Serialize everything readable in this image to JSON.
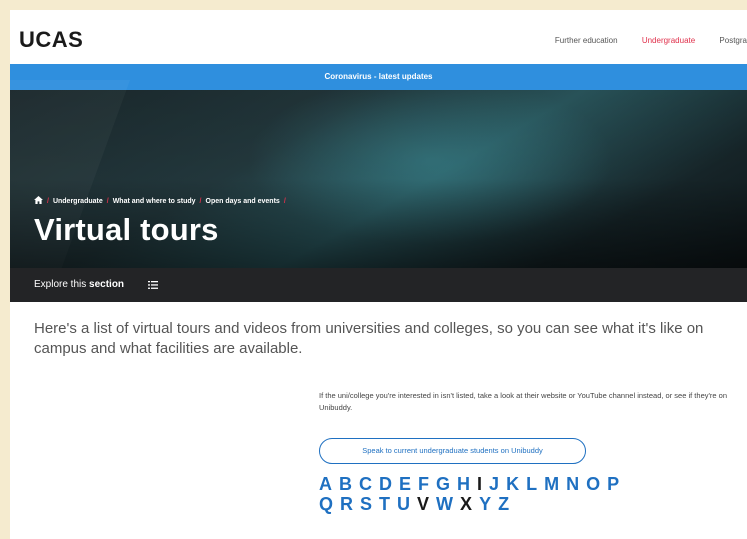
{
  "header": {
    "logo": "UCAS",
    "nav": [
      {
        "label": "Further education",
        "active": false
      },
      {
        "label": "Undergraduate",
        "active": true
      },
      {
        "label": "Postgra",
        "active": false
      }
    ]
  },
  "banner": {
    "text": "Coronavirus - latest updates"
  },
  "breadcrumb": [
    {
      "label": "Undergraduate"
    },
    {
      "label": "What and where to study"
    },
    {
      "label": "Open days and events"
    }
  ],
  "page_title": "Virtual tours",
  "explore": {
    "label_prefix": "Explore this ",
    "label_strong": "section"
  },
  "intro": "Here's a list of virtual tours and videos from universities and colleges, so you can see what it's like on campus and what facilities are available.",
  "note": "If the uni/college you're interested in isn't listed, take a look at their website or YouTube channel instead, or see if they're on Unibuddy.",
  "unibuddy_button": "Speak to current undergraduate students on Unibuddy",
  "alphabet": [
    {
      "letter": "A",
      "active": true
    },
    {
      "letter": "B",
      "active": true
    },
    {
      "letter": "C",
      "active": true
    },
    {
      "letter": "D",
      "active": true
    },
    {
      "letter": "E",
      "active": true
    },
    {
      "letter": "F",
      "active": true
    },
    {
      "letter": "G",
      "active": true
    },
    {
      "letter": "H",
      "active": true
    },
    {
      "letter": "I",
      "active": false
    },
    {
      "letter": "J",
      "active": true
    },
    {
      "letter": "K",
      "active": true
    },
    {
      "letter": "L",
      "active": true
    },
    {
      "letter": "M",
      "active": true
    },
    {
      "letter": "N",
      "active": true
    },
    {
      "letter": "O",
      "active": true
    },
    {
      "letter": "P",
      "active": true
    },
    {
      "letter": "Q",
      "active": true
    },
    {
      "letter": "R",
      "active": true
    },
    {
      "letter": "S",
      "active": true
    },
    {
      "letter": "T",
      "active": true
    },
    {
      "letter": "U",
      "active": true
    },
    {
      "letter": "V",
      "active": false
    },
    {
      "letter": "W",
      "active": true
    },
    {
      "letter": "X",
      "active": false
    },
    {
      "letter": "Y",
      "active": true
    },
    {
      "letter": "Z",
      "active": true
    }
  ],
  "colors": {
    "brand_blue": "#2f8fde",
    "link_blue": "#1f70c1",
    "accent_red": "#e0304b",
    "dark_bar": "#232426"
  }
}
